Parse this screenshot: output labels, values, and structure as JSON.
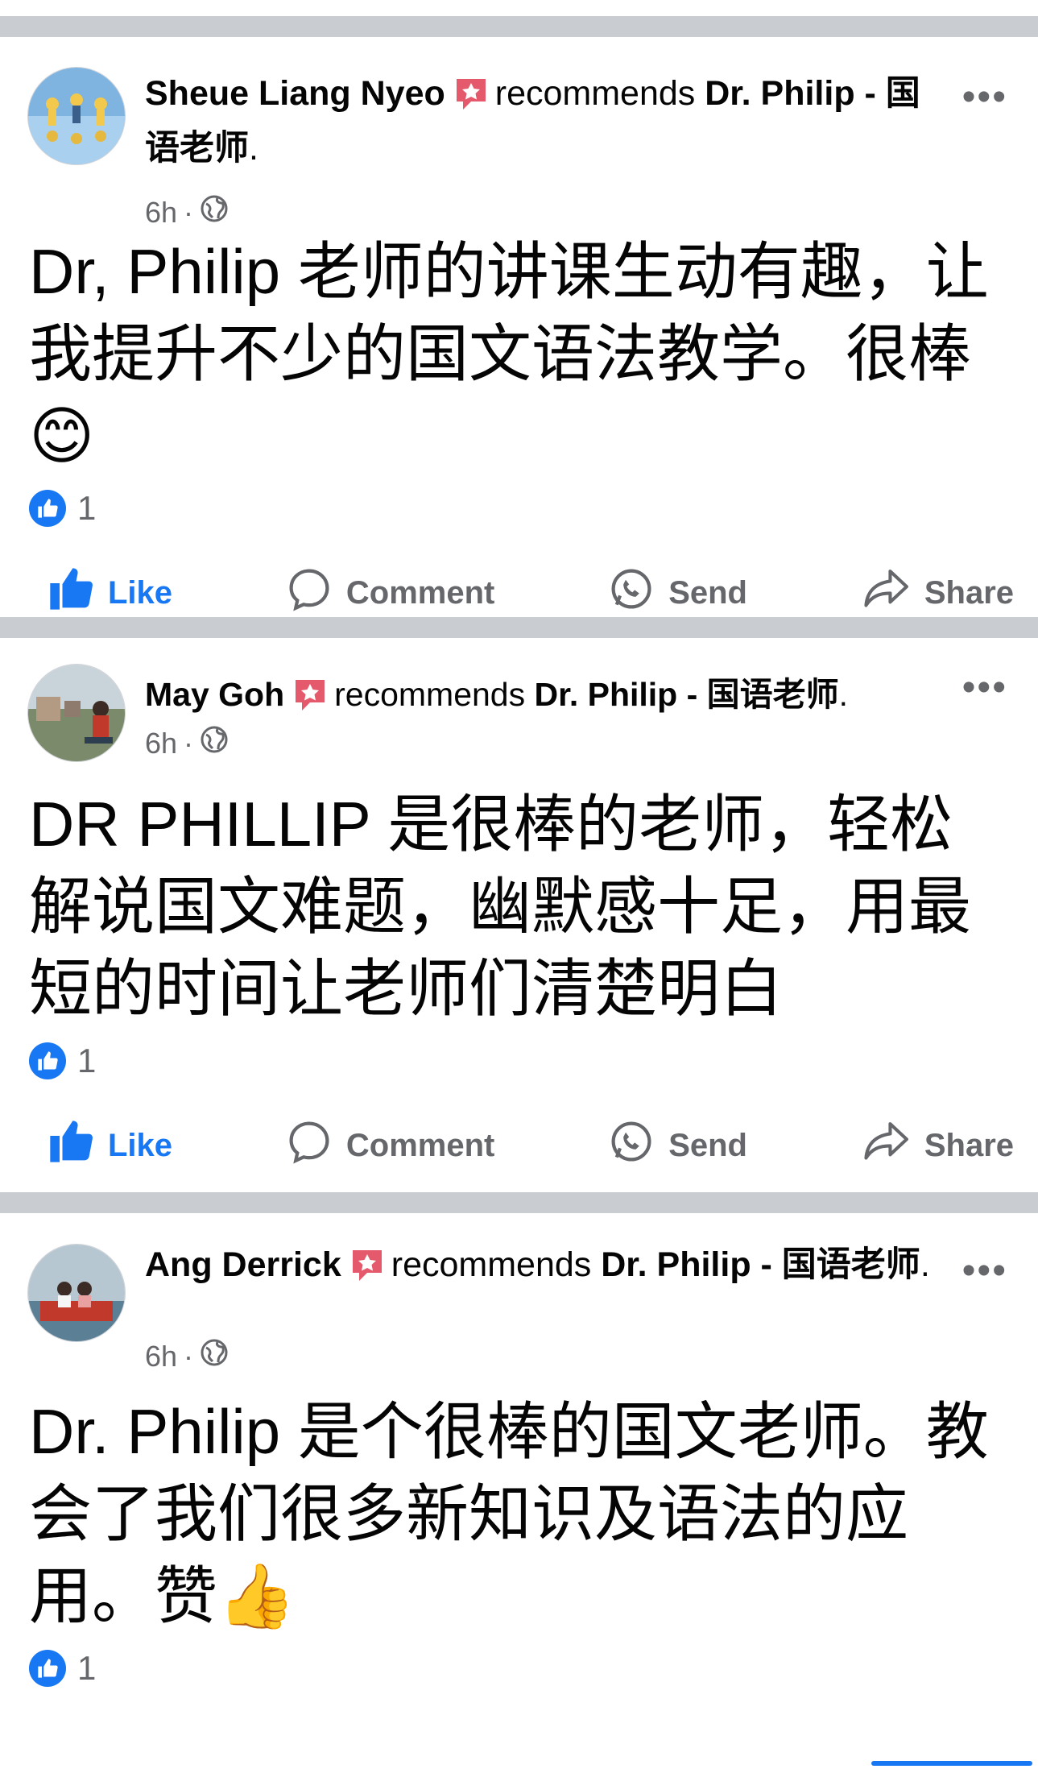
{
  "posts": [
    {
      "author": "Sheue Liang  Nyeo",
      "recommends_text": "recommends",
      "page_name": "Dr. Philip - 国语老师",
      "page_suffix": ".",
      "time": "6h",
      "meta_sep": "·",
      "body": "Dr, Philip 老师的讲课生动有趣，让我提升不少的国文语法教学。很棒😊",
      "like_count": "1",
      "more": "•••"
    },
    {
      "author": "May Goh",
      "recommends_text": "recommends",
      "page_name": "Dr. Philip - 国语老师",
      "page_suffix": ".",
      "time": "6h",
      "meta_sep": "·",
      "body": "DR PHILLIP 是很棒的老师，轻松解说国文难题，幽默感十足，用最短的时间让老师们清楚明白",
      "like_count": "1",
      "more": "•••"
    },
    {
      "author": "Ang Derrick",
      "recommends_text": "recommends",
      "page_name": "Dr. Philip - 国语老师",
      "page_suffix": ".",
      "time": "6h",
      "meta_sep": "·",
      "body": "Dr. Philip 是个很棒的国文老师。教会了我们很多新知识及语法的应用。赞👍",
      "like_count": "1",
      "more": "•••"
    }
  ],
  "actions": {
    "like": "Like",
    "comment": "Comment",
    "send": "Send",
    "share": "Share"
  },
  "colors": {
    "accent": "#1877f2",
    "divider": "#c9ccd1",
    "secondary_text": "#65676b",
    "recommend_icon": "#e4596b"
  },
  "icons": [
    "recommend-star-icon",
    "globe-icon",
    "more-options-icon",
    "like-thumb-icon",
    "comment-bubble-icon",
    "messenger-send-icon",
    "share-arrow-icon"
  ]
}
